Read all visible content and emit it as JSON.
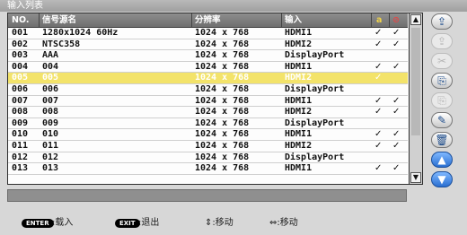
{
  "window": {
    "title": "输入列表"
  },
  "table": {
    "headers": {
      "no": "NO.",
      "name": "信号源名",
      "resolution": "分辨率",
      "input": "输入",
      "col_lock": "a",
      "col_skip": "⊘"
    },
    "rows": [
      {
        "no": "001",
        "name": "1280x1024 60Hz",
        "resolution": "1024 x 768",
        "input": "HDMI1",
        "m1": "✓",
        "m2": "✓"
      },
      {
        "no": "002",
        "name": "NTSC358",
        "resolution": "1024 x 768",
        "input": "HDMI2",
        "m1": "✓",
        "m2": "✓"
      },
      {
        "no": "003",
        "name": "AAA",
        "resolution": "1024 x 768",
        "input": "DisplayPort",
        "m1": "",
        "m2": ""
      },
      {
        "no": "004",
        "name": "004",
        "resolution": "1024 x 768",
        "input": "HDMI1",
        "m1": "✓",
        "m2": "✓"
      },
      {
        "no": "005",
        "name": "005",
        "resolution": "1024 x 768",
        "input": "HDMI2",
        "m1": "✓",
        "m2": ""
      },
      {
        "no": "006",
        "name": "006",
        "resolution": "1024 x 768",
        "input": "DisplayPort",
        "m1": "",
        "m2": ""
      },
      {
        "no": "007",
        "name": "007",
        "resolution": "1024 x 768",
        "input": "HDMI1",
        "m1": "✓",
        "m2": "✓"
      },
      {
        "no": "008",
        "name": "008",
        "resolution": "1024 x 768",
        "input": "HDMI2",
        "m1": "✓",
        "m2": "✓"
      },
      {
        "no": "009",
        "name": "009",
        "resolution": "1024 x 768",
        "input": "DisplayPort",
        "m1": "",
        "m2": ""
      },
      {
        "no": "010",
        "name": "010",
        "resolution": "1024 x 768",
        "input": "HDMI1",
        "m1": "✓",
        "m2": "✓"
      },
      {
        "no": "011",
        "name": "011",
        "resolution": "1024 x 768",
        "input": "HDMI2",
        "m1": "✓",
        "m2": "✓"
      },
      {
        "no": "012",
        "name": "012",
        "resolution": "1024 x 768",
        "input": "DisplayPort",
        "m1": "",
        "m2": ""
      },
      {
        "no": "013",
        "name": "013",
        "resolution": "1024 x 768",
        "input": "HDMI1",
        "m1": "✓",
        "m2": "✓"
      }
    ],
    "selected_row": "005"
  },
  "scrollbar": {
    "up": "▲",
    "down": "▼"
  },
  "side_buttons": [
    {
      "icon": "⇪",
      "state": "on"
    },
    {
      "icon": "⇪",
      "state": "off"
    },
    {
      "icon": "✂",
      "state": "off"
    },
    {
      "icon": "⎘",
      "state": "on"
    },
    {
      "icon": "⎘",
      "state": "off"
    },
    {
      "icon": "✎",
      "state": "on"
    },
    {
      "icon": "🗑",
      "state": "on"
    },
    {
      "icon": "▲",
      "state": "blue"
    },
    {
      "icon": "▼",
      "state": "blue"
    }
  ],
  "footer": {
    "enter_key": "ENTER",
    "enter_text": ":载入",
    "exit_key": "EXIT",
    "exit_text": ":退出",
    "updown_text": "⇕:移动",
    "leftright_text": "⇔:移动"
  },
  "colors": {
    "selected_row": "#f3e36a",
    "header_bg": "#7d7d7d",
    "accent_blue": "#2a6fd1"
  }
}
